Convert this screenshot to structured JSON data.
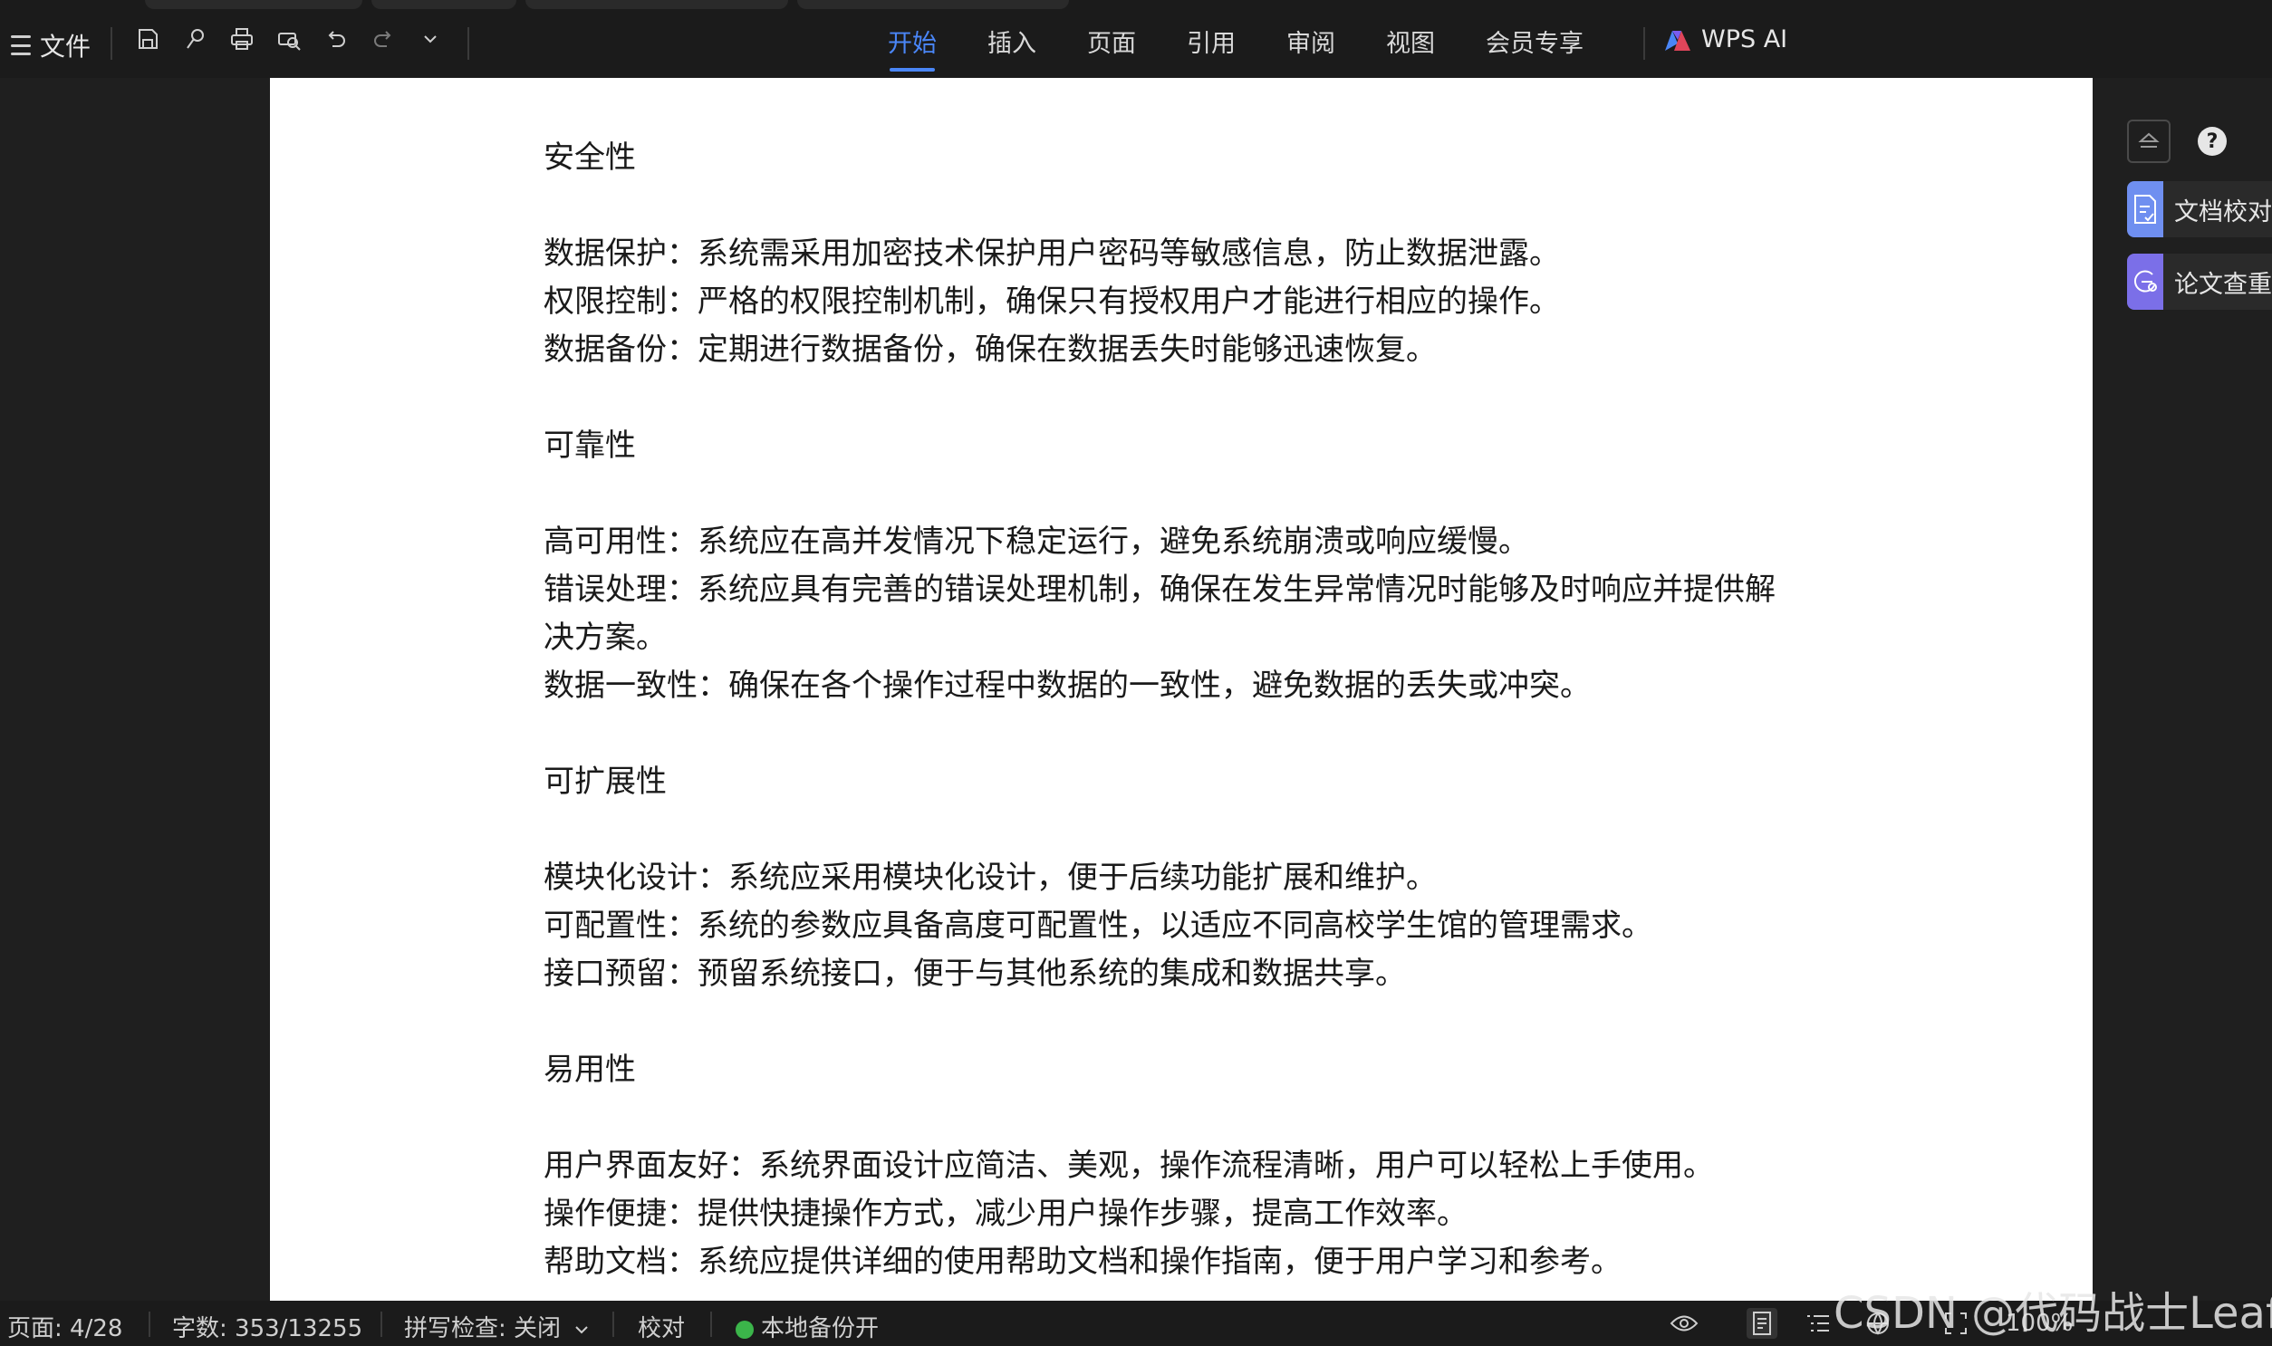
{
  "toolbar": {
    "file_label": "文件",
    "tabs": [
      "开始",
      "插入",
      "页面",
      "引用",
      "审阅",
      "视图",
      "会员专享"
    ],
    "active_tab": "开始",
    "wps_ai_label": "WPS AI"
  },
  "document": {
    "paragraphs": [
      "安全性",
      "",
      "数据保护：系统需采用加密技术保护用户密码等敏感信息，防止数据泄露。",
      "权限控制：严格的权限控制机制，确保只有授权用户才能进行相应的操作。",
      "数据备份：定期进行数据备份，确保在数据丢失时能够迅速恢复。",
      "",
      "可靠性",
      "",
      "高可用性：系统应在高并发情况下稳定运行，避免系统崩溃或响应缓慢。",
      "错误处理：系统应具有完善的错误处理机制，确保在发生异常情况时能够及时响应并提供解",
      "决方案。",
      "数据一致性：确保在各个操作过程中数据的一致性，避免数据的丢失或冲突。",
      "",
      "可扩展性",
      "",
      "模块化设计：系统应采用模块化设计，便于后续功能扩展和维护。",
      "可配置性：系统的参数应具备高度可配置性，以适应不同高校学生馆的管理需求。",
      "接口预留：预留系统接口，便于与其他系统的集成和数据共享。",
      "",
      "易用性",
      "",
      "用户界面友好：系统界面设计应简洁、美观，操作流程清晰，用户可以轻松上手使用。",
      "操作便捷：提供快捷操作方式，减少用户操作步骤，提高工作效率。",
      "帮助文档：系统应提供详细的使用帮助文档和操作指南，便于用户学习和参考。"
    ]
  },
  "right_panel": {
    "help_label": "?",
    "buttons": [
      "文档校对",
      "论文查重"
    ]
  },
  "status": {
    "page": "页面: 4/28",
    "word_count": "字数: 353/13255",
    "spell_check": "拼写检查: 关闭",
    "proofread": "校对",
    "backup": "本地备份开",
    "zoom": "100%"
  },
  "watermark": "CSDN @代码战士Leaf",
  "colors": {
    "accent": "#4a86f7",
    "chrome_bg": "#1b1b1b",
    "page_bg": "#ffffff",
    "backup_green": "#3bb54a"
  },
  "icons": [
    "menu-icon",
    "save-icon",
    "format-painter-icon",
    "print-icon",
    "print-preview-icon",
    "undo-icon",
    "redo-icon",
    "more-chevron-icon",
    "wps-ai-logo-icon",
    "collapse-icon",
    "help-icon",
    "doc-check-icon",
    "plagiarism-check-icon",
    "eye-icon",
    "page-view-icon",
    "outline-icon",
    "web-view-icon",
    "fit-page-icon"
  ]
}
